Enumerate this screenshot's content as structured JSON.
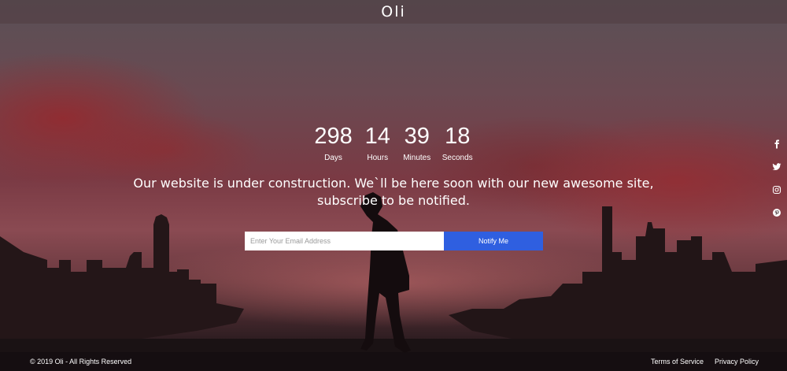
{
  "header": {
    "logo": "Oli"
  },
  "countdown": [
    {
      "value": "298",
      "label": "Days"
    },
    {
      "value": "14",
      "label": "Hours"
    },
    {
      "value": "39",
      "label": "Minutes"
    },
    {
      "value": "18",
      "label": "Seconds"
    }
  ],
  "message": {
    "line1": "Our website is under construction. We`ll be here soon with our new awesome site,",
    "line2": "subscribe to be notified."
  },
  "form": {
    "email_placeholder": "Enter Your Email Address",
    "email_value": "",
    "button_label": "Notify Me"
  },
  "social": [
    "facebook-icon",
    "twitter-icon",
    "instagram-icon",
    "pinterest-icon"
  ],
  "footer": {
    "copyright": "© 2019 Oli - All Rights Reserved",
    "links": [
      "Terms of Service",
      "Privacy Policy"
    ]
  },
  "colors": {
    "accent": "#2f5fe0",
    "header_bg": "#50423e",
    "footer_bg": "#140e10"
  }
}
